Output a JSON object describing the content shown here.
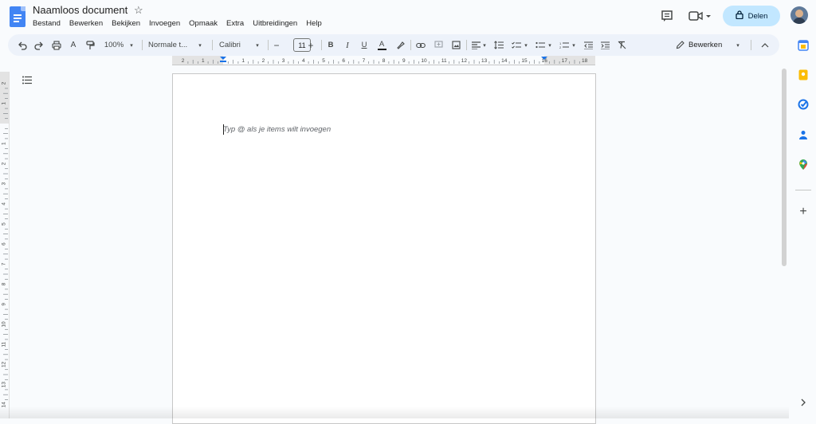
{
  "document": {
    "title": "Naamloos document",
    "placeholder": "Typ @ als je items wilt invoegen"
  },
  "menu": [
    "Bestand",
    "Bewerken",
    "Bekijken",
    "Invoegen",
    "Opmaak",
    "Extra",
    "Uitbreidingen",
    "Help"
  ],
  "header": {
    "share_label": "Delen"
  },
  "toolbar": {
    "zoom": "100%",
    "style": "Normale t...",
    "font": "Calibri",
    "font_size": "11",
    "mode": "Bewerken"
  },
  "ruler": {
    "h_labels": [
      "2",
      "1",
      "1",
      "2",
      "3",
      "4",
      "5",
      "6",
      "7",
      "8",
      "9",
      "10",
      "11",
      "12",
      "13",
      "14",
      "15",
      "16",
      "17",
      "18"
    ],
    "v_labels": [
      "2",
      "1",
      "1",
      "2",
      "3",
      "4",
      "5",
      "6",
      "7",
      "8",
      "9",
      "10",
      "11",
      "12",
      "13",
      "14"
    ]
  },
  "icons": {
    "docs": "docs-logo-icon",
    "star": "star-icon",
    "comments": "comment-icon",
    "meet": "video-call-icon",
    "lock": "lock-icon",
    "outline": "outline-icon",
    "calendar": "calendar-icon",
    "keep": "keep-icon",
    "tasks": "tasks-icon",
    "contacts": "contacts-icon",
    "maps": "maps-icon",
    "add": "add-icon"
  },
  "colors": {
    "accent": "#4285f4",
    "share_bg": "#c2e7ff",
    "toolbar_bg": "#edf2fa",
    "page_bg": "#f9fbfd"
  }
}
